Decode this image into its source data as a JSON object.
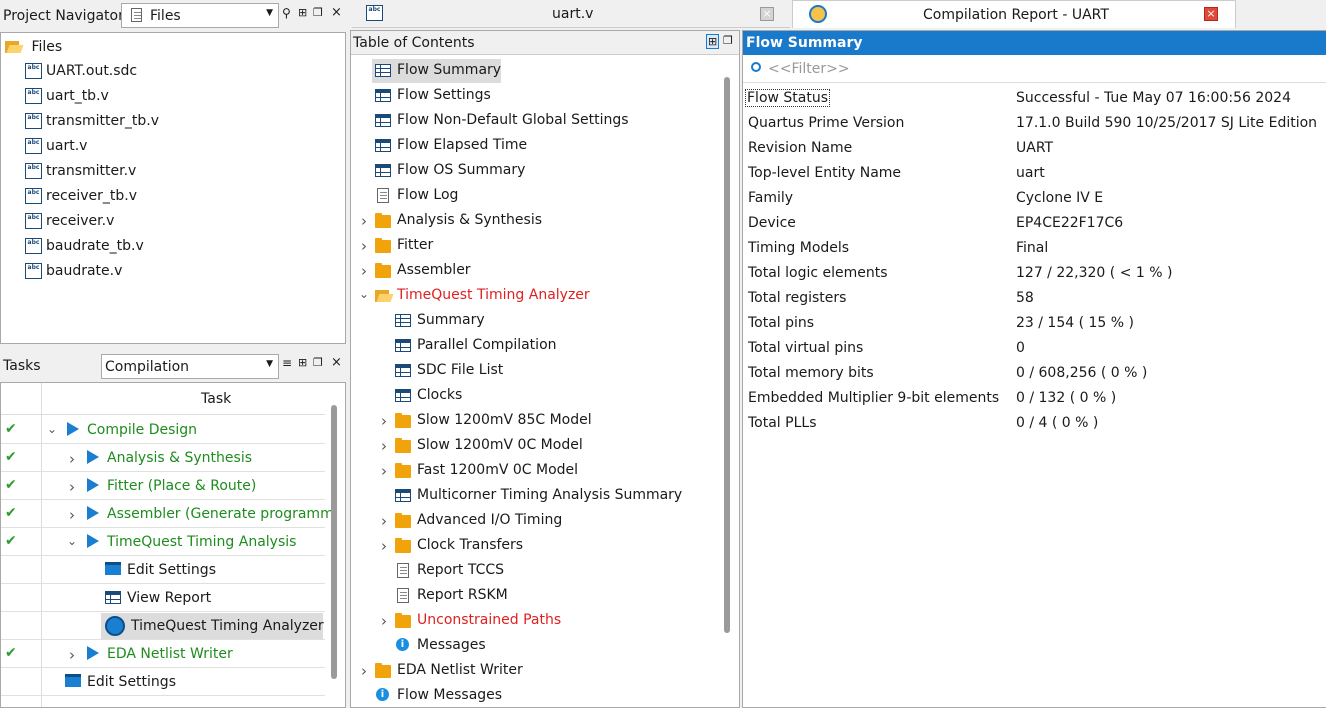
{
  "project_navigator": {
    "title": "Project Navigator",
    "view_select": "Files",
    "root_label": "Files",
    "files": [
      "UART.out.sdc",
      "uart_tb.v",
      "transmitter_tb.v",
      "uart.v",
      "transmitter.v",
      "receiver_tb.v",
      "receiver.v",
      "baudrate_tb.v",
      "baudrate.v"
    ]
  },
  "tasks": {
    "title": "Tasks",
    "flow_select": "Compilation",
    "column_header": "Task",
    "rows": [
      {
        "label": "Compile Design",
        "status": "done",
        "indent": 0,
        "expand": "open",
        "icon": "play",
        "color": "#1e8c1e"
      },
      {
        "label": "Analysis & Synthesis",
        "status": "done",
        "indent": 1,
        "expand": "closed",
        "icon": "play",
        "color": "#1e8c1e"
      },
      {
        "label": "Fitter (Place & Route)",
        "status": "done",
        "indent": 1,
        "expand": "closed",
        "icon": "play",
        "color": "#1e8c1e"
      },
      {
        "label": "Assembler (Generate programm",
        "status": "done",
        "indent": 1,
        "expand": "closed",
        "icon": "play",
        "color": "#1e8c1e"
      },
      {
        "label": "TimeQuest Timing Analysis",
        "status": "done",
        "indent": 1,
        "expand": "open",
        "icon": "play",
        "color": "#1e8c1e"
      },
      {
        "label": "Edit Settings",
        "status": "",
        "indent": 2,
        "expand": "",
        "icon": "settings",
        "color": "#1a1a1a"
      },
      {
        "label": "View Report",
        "status": "",
        "indent": 2,
        "expand": "",
        "icon": "table",
        "color": "#1a1a1a"
      },
      {
        "label": "TimeQuest Timing Analyzer",
        "status": "",
        "indent": 2,
        "expand": "",
        "icon": "clock",
        "color": "#1a1a1a",
        "selected": true
      },
      {
        "label": "EDA Netlist Writer",
        "status": "done",
        "indent": 1,
        "expand": "closed",
        "icon": "play",
        "color": "#1e8c1e"
      },
      {
        "label": "Edit Settings",
        "status": "",
        "indent": 0,
        "expand": "",
        "icon": "settings",
        "color": "#1a1a1a"
      }
    ]
  },
  "tabs": [
    {
      "label": "uart.v",
      "active": false
    },
    {
      "label": "Compilation Report - UART",
      "active": true
    }
  ],
  "toc": {
    "title": "Table of Contents",
    "items": [
      {
        "label": "Flow Summary",
        "indent": 0,
        "icon": "table-top",
        "expand": "",
        "selected": true
      },
      {
        "label": "Flow Settings",
        "indent": 0,
        "icon": "table",
        "expand": ""
      },
      {
        "label": "Flow Non-Default Global Settings",
        "indent": 0,
        "icon": "table",
        "expand": ""
      },
      {
        "label": "Flow Elapsed Time",
        "indent": 0,
        "icon": "table",
        "expand": ""
      },
      {
        "label": "Flow OS Summary",
        "indent": 0,
        "icon": "table",
        "expand": ""
      },
      {
        "label": "Flow Log",
        "indent": 0,
        "icon": "doc",
        "expand": ""
      },
      {
        "label": "Analysis & Synthesis",
        "indent": 0,
        "icon": "folder",
        "expand": "closed"
      },
      {
        "label": "Fitter",
        "indent": 0,
        "icon": "folder",
        "expand": "closed"
      },
      {
        "label": "Assembler",
        "indent": 0,
        "icon": "folder",
        "expand": "closed"
      },
      {
        "label": "TimeQuest Timing Analyzer",
        "indent": 0,
        "icon": "folder-open",
        "expand": "open",
        "red": true
      },
      {
        "label": "Summary",
        "indent": 1,
        "icon": "table-top",
        "expand": ""
      },
      {
        "label": "Parallel Compilation",
        "indent": 1,
        "icon": "table",
        "expand": ""
      },
      {
        "label": "SDC File List",
        "indent": 1,
        "icon": "table",
        "expand": ""
      },
      {
        "label": "Clocks",
        "indent": 1,
        "icon": "table",
        "expand": ""
      },
      {
        "label": "Slow 1200mV 85C Model",
        "indent": 1,
        "icon": "folder",
        "expand": "closed"
      },
      {
        "label": "Slow 1200mV 0C Model",
        "indent": 1,
        "icon": "folder",
        "expand": "closed"
      },
      {
        "label": "Fast 1200mV 0C Model",
        "indent": 1,
        "icon": "folder",
        "expand": "closed"
      },
      {
        "label": "Multicorner Timing Analysis Summary",
        "indent": 1,
        "icon": "table",
        "expand": ""
      },
      {
        "label": "Advanced I/O Timing",
        "indent": 1,
        "icon": "folder",
        "expand": "closed"
      },
      {
        "label": "Clock Transfers",
        "indent": 1,
        "icon": "folder",
        "expand": "closed"
      },
      {
        "label": "Report TCCS",
        "indent": 1,
        "icon": "doc",
        "expand": ""
      },
      {
        "label": "Report RSKM",
        "indent": 1,
        "icon": "doc",
        "expand": ""
      },
      {
        "label": "Unconstrained Paths",
        "indent": 1,
        "icon": "folder",
        "expand": "closed",
        "red": true
      },
      {
        "label": "Messages",
        "indent": 1,
        "icon": "info",
        "expand": ""
      },
      {
        "label": "EDA Netlist Writer",
        "indent": 0,
        "icon": "folder",
        "expand": "closed"
      },
      {
        "label": "Flow Messages",
        "indent": 0,
        "icon": "info",
        "expand": ""
      }
    ]
  },
  "summary": {
    "title": "Flow Summary",
    "filter_placeholder": "<<Filter>>",
    "rows": [
      {
        "key": "Flow Status",
        "value": "Successful - Tue May 07 16:00:56 2024"
      },
      {
        "key": "Quartus Prime Version",
        "value": "17.1.0 Build 590 10/25/2017 SJ Lite Edition"
      },
      {
        "key": "Revision Name",
        "value": "UART"
      },
      {
        "key": "Top-level Entity Name",
        "value": "uart"
      },
      {
        "key": "Family",
        "value": "Cyclone IV E"
      },
      {
        "key": "Device",
        "value": "EP4CE22F17C6"
      },
      {
        "key": "Timing Models",
        "value": "Final"
      },
      {
        "key": "Total logic elements",
        "value": "127 / 22,320 ( < 1 % )"
      },
      {
        "key": "Total registers",
        "value": "58"
      },
      {
        "key": "Total pins",
        "value": "23 / 154 ( 15 % )"
      },
      {
        "key": "Total virtual pins",
        "value": "0"
      },
      {
        "key": "Total memory bits",
        "value": "0 / 608,256 ( 0 % )"
      },
      {
        "key": "Embedded Multiplier 9-bit elements",
        "value": "0 / 132 ( 0 % )"
      },
      {
        "key": "Total PLLs",
        "value": "0 / 4 ( 0 % )"
      }
    ]
  },
  "colors": {
    "accent": "#1979ca",
    "red": "#e02020",
    "green": "#1e8c1e"
  }
}
